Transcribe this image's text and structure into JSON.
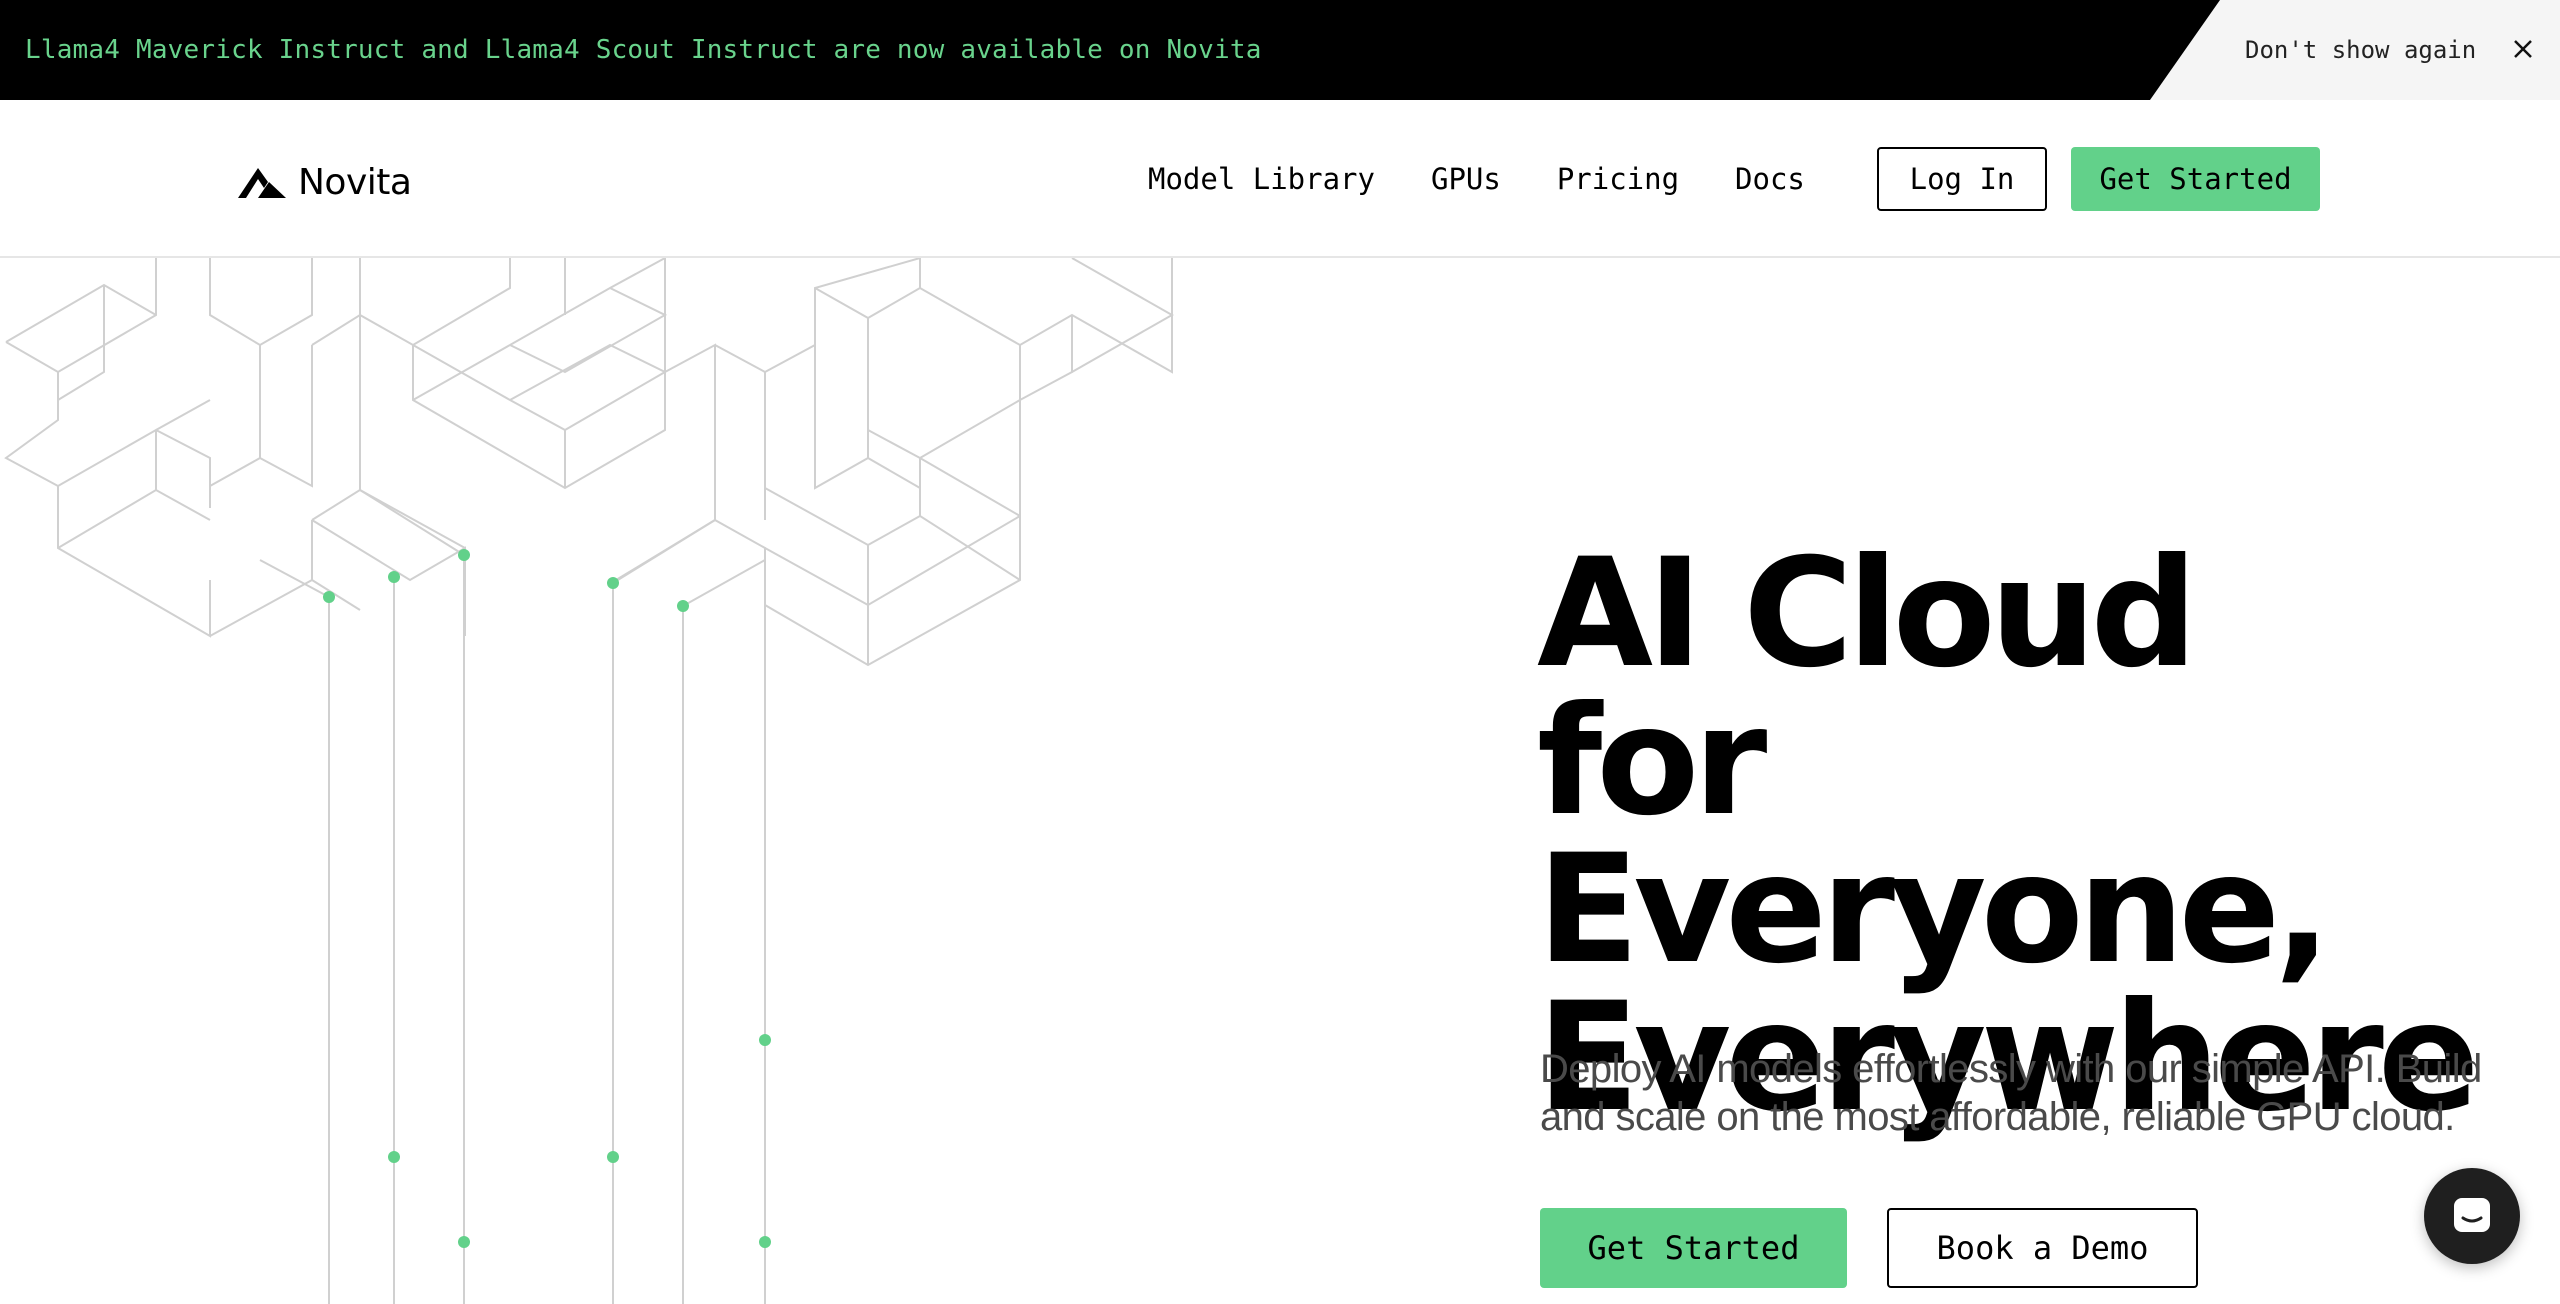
{
  "banner": {
    "message": "Llama4 Maverick Instruct and Llama4 Scout Instruct are now available on Novita",
    "dismiss_label": "Don't show again",
    "close_icon": "close-icon"
  },
  "nav": {
    "brand": "Novita",
    "links": [
      {
        "label": "Model Library"
      },
      {
        "label": "GPUs"
      },
      {
        "label": "Pricing"
      },
      {
        "label": "Docs"
      }
    ],
    "login_label": "Log In",
    "get_started_label": "Get Started"
  },
  "hero": {
    "title_line1": "AI Cloud for",
    "title_line2": "Everyone,",
    "title_line3": "Everywhere",
    "subtitle": "Deploy AI models effortlessly with our simple API. Build and scale on the most affordable, reliable GPU cloud.",
    "primary_cta": "Get Started",
    "secondary_cta": "Book a Demo"
  },
  "chat": {
    "icon": "chat-icon"
  },
  "colors": {
    "accent_green": "#62d18a",
    "banner_text": "#69d38c",
    "banner_bg": "#000000",
    "line_gray": "#d0d0d0"
  }
}
